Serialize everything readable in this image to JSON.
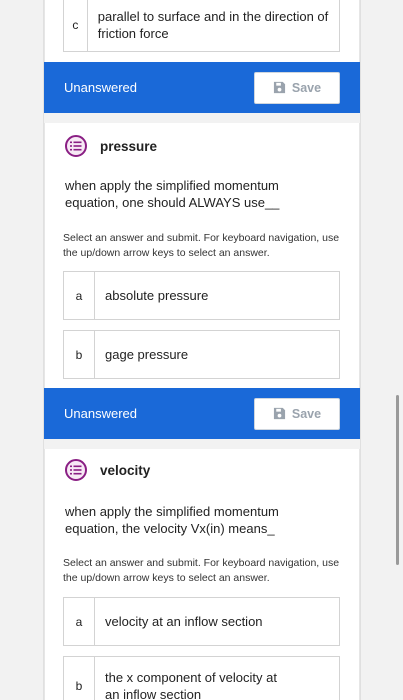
{
  "prev_question": {
    "option_c": {
      "letter": "c",
      "text": "parallel to surface and in the direction of friction force"
    },
    "status": "Unanswered",
    "save_label": "Save"
  },
  "q_pressure": {
    "title": "pressure",
    "prompt": "when apply the simplified momentum equation, one should ALWAYS use__",
    "hint": "Select an answer and submit. For keyboard navigation, use the up/down arrow keys to select an answer.",
    "options": [
      {
        "letter": "a",
        "text": "absolute pressure"
      },
      {
        "letter": "b",
        "text": "gage pressure"
      }
    ],
    "status": "Unanswered",
    "save_label": "Save"
  },
  "q_velocity": {
    "title": "velocity",
    "prompt": "when apply the simplified momentum equation, the velocity Vx(in) means_",
    "hint": "Select an answer and submit. For keyboard navigation, use the up/down arrow keys to select an answer.",
    "options": [
      {
        "letter": "a",
        "text": "velocity at an inflow section"
      },
      {
        "letter": "b",
        "text": "the x component of velocity at an inflow section"
      }
    ]
  },
  "icons": {
    "question": "question-list-icon",
    "save": "floppy-disk-icon"
  },
  "colors": {
    "status_bar": "#1a69d8",
    "question_icon": "#8a1f84"
  }
}
